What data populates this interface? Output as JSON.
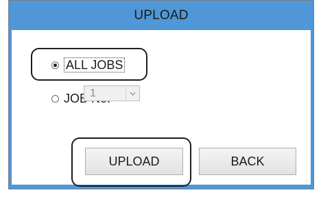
{
  "dialog": {
    "title": "UPLOAD"
  },
  "options": {
    "all_jobs_label": "ALL JOBS",
    "all_jobs_selected": true,
    "job_no_label": "JOB No.",
    "job_no_selected": false
  },
  "job_select": {
    "value": "1",
    "enabled": false
  },
  "buttons": {
    "upload_label": "UPLOAD",
    "back_label": "BACK"
  },
  "icons": {
    "dropdown": "chevron-down-icon",
    "radio": "radio-icon"
  },
  "colors": {
    "title_bar": "#4f97d6",
    "highlight_outline": "#1c1c1c"
  }
}
